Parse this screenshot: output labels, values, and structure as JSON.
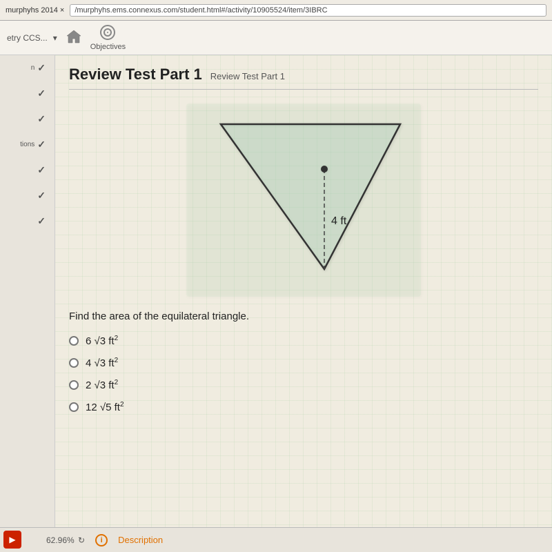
{
  "browser": {
    "url": "/murphyhs.ems.connexus.com/student.html#/activity/10905524/item/3IBRC"
  },
  "toolbar": {
    "course_label": "etry CCS...",
    "objectives_label": "Objectives"
  },
  "sidebar": {
    "items": [
      {
        "label": "n",
        "checked": true
      },
      {
        "label": "",
        "checked": true
      },
      {
        "label": "",
        "checked": true
      },
      {
        "label": "tions",
        "checked": true
      },
      {
        "label": "",
        "checked": true
      },
      {
        "label": "",
        "checked": true
      },
      {
        "label": "",
        "checked": true
      }
    ]
  },
  "page": {
    "title": "Review Test Part 1",
    "subtitle": "Review Test Part 1"
  },
  "diagram": {
    "label": "4 ft",
    "alt": "Equilateral triangle pointing downward with height of 4 ft shown"
  },
  "question": {
    "text": "Find the area of the equilateral triangle."
  },
  "answers": [
    {
      "id": "a",
      "text": "6 √3  ft²"
    },
    {
      "id": "b",
      "text": "4 √3  ft²"
    },
    {
      "id": "c",
      "text": "2 √3  ft²"
    },
    {
      "id": "d",
      "text": "12 √5  ft²"
    }
  ],
  "bottom_bar": {
    "progress": "62.96%",
    "description_label": "Description"
  }
}
